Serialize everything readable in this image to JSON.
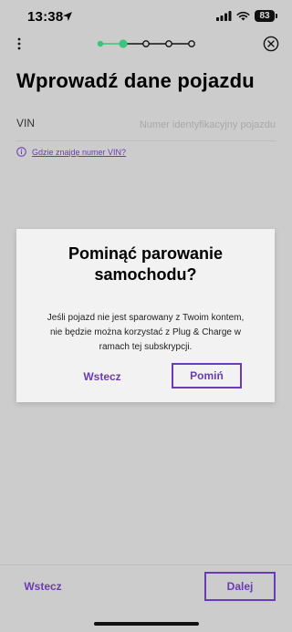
{
  "status_bar": {
    "time": "13:38",
    "battery": "83"
  },
  "stepper": {
    "total_steps": 5,
    "completed_steps": 1,
    "current_step": 2,
    "active_color": "#3cc47c",
    "inactive_color": "#111111"
  },
  "page": {
    "title": "Wprowadź dane pojazdu"
  },
  "vin": {
    "label": "VIN",
    "value": "",
    "placeholder": "Numer identyfikacyjny pojazdu",
    "help_link": "Gdzie znajdę numer VIN?"
  },
  "dialog": {
    "title_lines": [
      "Pominąć parowanie",
      "samochodu?"
    ],
    "body_lines": [
      "Jeśli pojazd nie jest sparowany z Twoim kontem,",
      "nie będzie można korzystać z Plug & Charge w",
      "ramach tej subskrypcji."
    ],
    "back_label": "Wstecz",
    "skip_label": "Pomiń"
  },
  "footer": {
    "back_label": "Wstecz",
    "next_label": "Dalej"
  },
  "colors": {
    "accent": "#6a3bb5",
    "overlay_background": "#cccccc",
    "dialog_background": "#f2f2f2"
  }
}
